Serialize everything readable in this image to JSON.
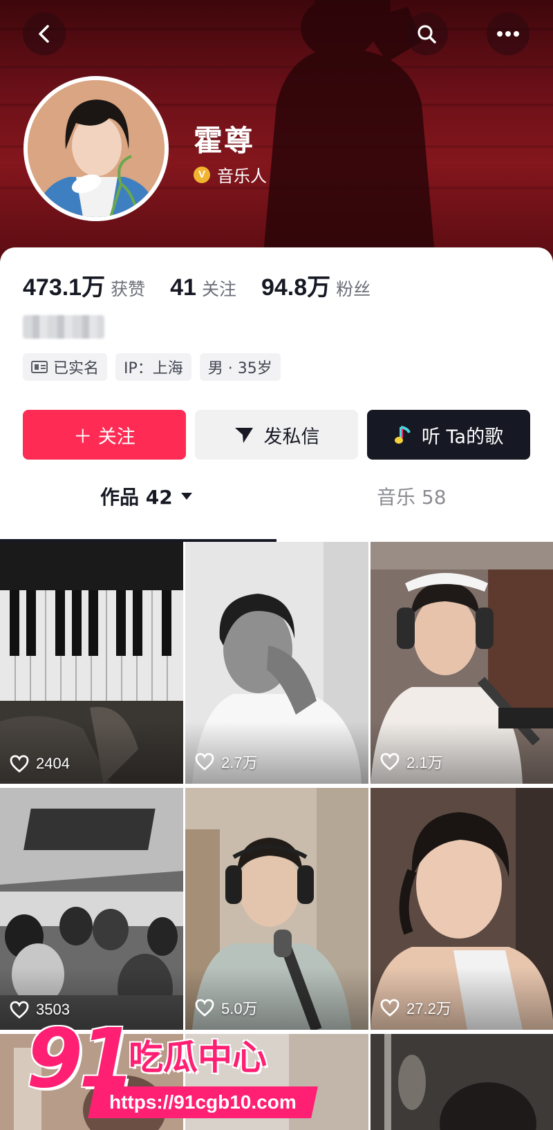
{
  "profile": {
    "name": "霍尊",
    "verification_label": "音乐人"
  },
  "stats": [
    {
      "value": "473.1万",
      "label": "获赞"
    },
    {
      "value": "41",
      "label": "关注"
    },
    {
      "value": "94.8万",
      "label": "粉丝"
    }
  ],
  "tags": {
    "verified": "已实名",
    "ip": "IP：上海",
    "gender_age": "男 · 35岁"
  },
  "actions": {
    "follow": "＋ 关注",
    "message": "发私信",
    "listen": "听 Ta的歌"
  },
  "tabs": {
    "works": "作品 42",
    "music": "音乐 58"
  },
  "videos": [
    {
      "likes": "2404"
    },
    {
      "likes": "2.7万"
    },
    {
      "likes": "2.1万"
    },
    {
      "likes": "3503"
    },
    {
      "likes": "5.0万"
    },
    {
      "likes": "27.2万"
    }
  ],
  "watermark": {
    "number": "91",
    "text": "吃瓜中心",
    "url": "https://91cgb10.com"
  },
  "colors": {
    "accent": "#fe2c55",
    "dark_button": "#161823",
    "header_red": "#84161d",
    "watermark_pink": "#ff1f73"
  },
  "icons": [
    "back-icon",
    "search-icon",
    "more-icon",
    "verified-v-icon",
    "id-card-icon",
    "send-icon",
    "music-note-icon",
    "caret-down-icon",
    "heart-icon"
  ]
}
